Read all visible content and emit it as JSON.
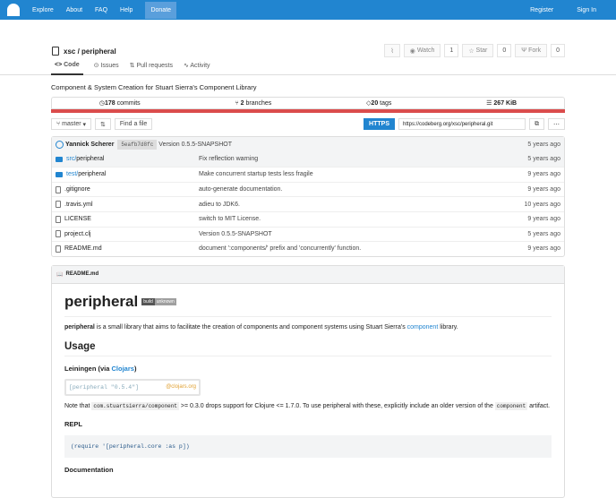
{
  "nav": {
    "items": [
      "Explore",
      "About",
      "FAQ",
      "Help"
    ],
    "donate": "Donate",
    "register": "Register",
    "signin": "Sign In"
  },
  "repo": {
    "title": "xsc / peripheral",
    "watch": "Watch",
    "watch_count": "1",
    "star": "Star",
    "star_count": "0",
    "fork": "Fork",
    "fork_count": "0",
    "tabs": [
      "Code",
      "Issues",
      "Pull requests",
      "Activity"
    ],
    "description": "Component & System Creation for Stuart Sierra's Component Library",
    "stats": {
      "commits": "178",
      "commits_label": "commits",
      "branches": "2",
      "branches_label": "branches",
      "tags": "20",
      "tags_label": "tags",
      "size": "267 KiB"
    },
    "branch": "master",
    "find_file": "Find a file",
    "https": "HTTPS",
    "clone_url": "https://codeberg.org/xsc/peripheral.git"
  },
  "latest_commit": {
    "author": "Yannick Scherer",
    "sha": "5eafb7d8fc",
    "message": "Version 0.5.5-SNAPSHOT",
    "time": "5 years ago"
  },
  "files": [
    {
      "prefix": "src/",
      "name": "peripheral",
      "type": "folder",
      "message": "Fix reflection warning",
      "time": "5 years ago"
    },
    {
      "prefix": "test/",
      "name": "peripheral",
      "type": "folder",
      "message": "Make concurrent startup tests less fragile",
      "time": "9 years ago"
    },
    {
      "prefix": "",
      "name": ".gitignore",
      "type": "file",
      "message": "auto-generate documentation.",
      "time": "9 years ago"
    },
    {
      "prefix": "",
      "name": ".travis.yml",
      "type": "file",
      "message": "adieu to JDK6.",
      "time": "10 years ago"
    },
    {
      "prefix": "",
      "name": "LICENSE",
      "type": "file",
      "message": "switch to MIT License.",
      "time": "9 years ago"
    },
    {
      "prefix": "",
      "name": "project.clj",
      "type": "file",
      "message": "Version 0.5.5-SNAPSHOT",
      "time": "5 years ago"
    },
    {
      "prefix": "",
      "name": "README.md",
      "type": "file",
      "message": "document ':components/' prefix and 'concurrently' function.",
      "time": "9 years ago"
    }
  ],
  "readme": {
    "filename": "README.md",
    "title": "peripheral",
    "badge_left": "build",
    "badge_right": "unknown",
    "intro_bold": "peripheral",
    "intro_text": " is a small library that aims to facilitate the creation of components and component systems using Stuart Sierra's ",
    "intro_link": "component",
    "intro_end": " library.",
    "usage": "Usage",
    "lein": "Leiningen (via ",
    "clojars": "Clojars",
    "lein_end": ")",
    "clj_code": "[peripheral \"0.5.4\"]",
    "clj_org": "@clojars.org",
    "note1": "Note that ",
    "note_code1": "com.stuartsierra/component",
    "note2": " >= 0.3.0 drops support for Clojure <= 1.7.0. To use peripheral with these, explicitly include an older version of the ",
    "note_code2": "component",
    "note3": " artifact.",
    "repl": "REPL",
    "repl_code": "(require '[peripheral.core :as p])",
    "documentation": "Documentation"
  }
}
